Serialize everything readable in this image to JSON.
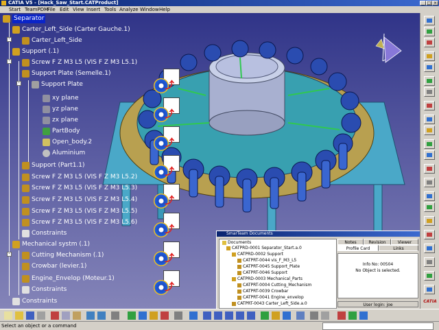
{
  "window": {
    "title": "CATIA V5 - [Hack_Saw_Start.CATProduct]"
  },
  "menu": [
    "Start",
    "TeamPDM",
    "File",
    "Edit",
    "View",
    "Insert",
    "Tools",
    "Analyze",
    "Window",
    "Help"
  ],
  "tree": {
    "root": "Separator",
    "items": [
      "Carter_Left_Side (Carter Gauche.1)",
      "Carter_Left_Side",
      "Support (.1)",
      "Screw F Z M3 L5 (VIS F Z M3 L5.1)",
      "Support Plate (Semelle.1)",
      "Support Plate",
      "xy plane",
      "yz plane",
      "zx plane",
      "PartBody",
      "Open_body.2",
      "Aluminium",
      "Support (Part1.1)",
      "Screw F Z M3 L5 (VIS F Z M3 L5.2)",
      "Screw F Z M3 L5 (VIS F Z M3 L5.3)",
      "Screw F Z M3 L5 (VIS F Z M3 L5.4)",
      "Screw F Z M3 L5 (VIS F Z M3 L5.5)",
      "Screw F Z M3 L5 (VIS F Z M3 L5.6)",
      "Constraints",
      "Mechanical systm (.1)",
      "Cutting Mechanism (.1)",
      "Crowbar (levier.1)",
      "Engine_Envelop (Moteur.1)",
      "Constraints",
      "Constraints"
    ]
  },
  "smarteam": {
    "title": "SmarTeam Documents",
    "root": "Documents",
    "rows": [
      "CATPRD-0001 Separator_Start.a.0",
      "CATPRD-0002 Support",
      "CATPRT-0044 vis_F_M3_L5",
      "CATPRT-0045 Support_Plate",
      "CATPRT-0046 Support",
      "CATPRD-0003 Mechanical_Parts",
      "CATPRT-0004 Cutting_Mechanism",
      "CATPRT-0039 Crowbar",
      "CATPRT-0041 Engine_envelop",
      "CATPRT-0043 Carter_Left_Side.a.0"
    ],
    "tabs_top": [
      "Notes",
      "Revision",
      "Viewer"
    ],
    "tabs_bottom": [
      "Profile Card",
      "Links"
    ],
    "info_no": "Info No: 00504",
    "info_msg": "No Object is selected.",
    "login": "User login: joe"
  },
  "status": {
    "text": "Select an object or a command"
  },
  "brand": "CATIA",
  "colors": {
    "accent": "#0a24c8",
    "viewport_top": "#303488",
    "viewport_bottom": "#8484b8"
  }
}
